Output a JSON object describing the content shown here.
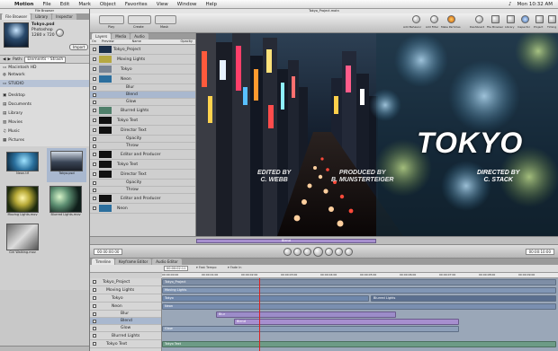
{
  "menubar": {
    "app": "Motion",
    "items": [
      "File",
      "Edit",
      "Mark",
      "Object",
      "Favorites",
      "View",
      "Window",
      "Help"
    ],
    "clock": "Mon 10:32 AM"
  },
  "browser": {
    "window_title": "File Browser",
    "tabs": [
      "File Browser",
      "Library",
      "Inspector"
    ],
    "preview": {
      "name": "Tokyo.psd",
      "line2": "Photoshop",
      "line3": "1280 x 720",
      "button": "Import"
    },
    "path_label": "Path:",
    "path_value": "Elements - Strash",
    "sidebar": [
      "Macintosh HD",
      "Network",
      "STUDIO",
      "Desktop",
      "Documents",
      "Library",
      "Movies",
      "Music",
      "Pictures"
    ],
    "thumbs": [
      "Neon.tif",
      "Tokyo.psd",
      "Moving Lights.mov",
      "Blurred Lights.mov",
      "Girl Walking.mov"
    ]
  },
  "canvas": {
    "window_title": "Tokyo_Project.motn",
    "toolbar_left": [
      "Play",
      "Create",
      "Mask"
    ],
    "toolbar_right": [
      "Add Behavior",
      "Add Filter",
      "Make Particles",
      "Dashboard",
      "File Browser",
      "Library",
      "Inspector",
      "Project",
      "Timing"
    ],
    "zoom": "100%",
    "layer_tabs": [
      "Layers",
      "Media",
      "Audio"
    ],
    "layer_cols": [
      "On",
      "Preview",
      "Name",
      "Opacity"
    ],
    "layers": [
      "Tokyo_Project",
      "Moving Lights",
      "Tokyo",
      "Neon",
      "Blur",
      "Blend",
      "Glow",
      "Blurred Lights",
      "Tokyo Text",
      "Director Text",
      "Opacity",
      "Throw",
      "Editor and Producer",
      "Tokyo Text",
      "Director Text",
      "Opacity",
      "Throw",
      "Editor and Producer",
      "Neon"
    ],
    "title": "TOKYO",
    "credit_left": "EDITED BY\nC. WEBB",
    "credit_mid": "PRODUCED BY\nB. MUNSTERTEIGER",
    "credit_right": "DIRECTED BY\nC. STACK"
  },
  "transport": {
    "timecode_left": "00:00:00:00",
    "timecode_right": "00:00:10:00",
    "mini_label": "Blend"
  },
  "timeline": {
    "tabs": [
      "Timeline",
      "Keyframe Editor",
      "Audio Editor"
    ],
    "timecode": "00:00:02:11",
    "ruler": [
      "00:00:00:00",
      "00:00:01:00",
      "00:00:02:00",
      "00:00:03:00",
      "00:00:04:00",
      "00:00:05:00",
      "00:00:06:00",
      "00:00:07:00",
      "00:00:08:00",
      "00:00:09:00"
    ],
    "tracks": [
      "Tokyo_Project",
      "Moving Lights",
      "Tokyo",
      "Neon",
      "Blur",
      "Blend",
      "Glow",
      "Blurred Lights",
      "Tokyo Text"
    ],
    "bars": [
      "Tokyo_Project",
      "Moving Lights",
      "Tokyo",
      "Neon",
      "Blur",
      "Blurred Lights",
      "Blend",
      "Glow",
      "Tokyo Text"
    ],
    "marker_a": "Fast Tempo",
    "marker_b": "Fade In"
  }
}
